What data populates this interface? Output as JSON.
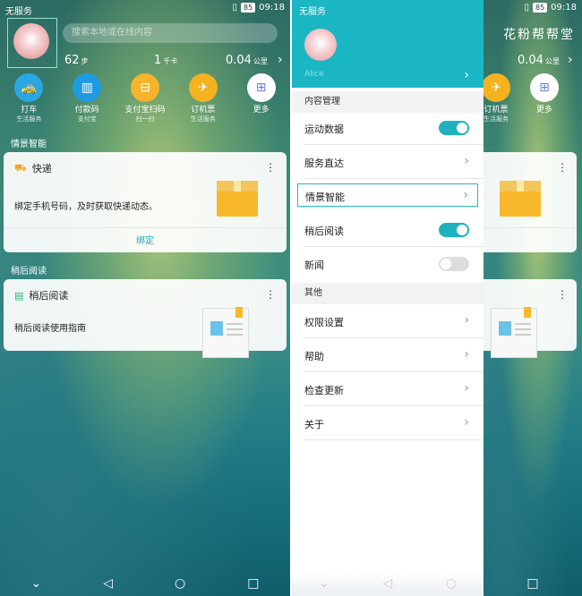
{
  "status_bar": {
    "carrier": "无服务",
    "battery": "85",
    "time": "09:18"
  },
  "home": {
    "search_placeholder": "搜索本地或在线内容",
    "stats": {
      "steps": "62",
      "steps_unit": "步",
      "calories": "1",
      "calories_unit": "千卡",
      "distance": "0.04",
      "distance_unit": "公里"
    },
    "quick_actions": [
      {
        "label": "打车",
        "sub": "生活服务",
        "color": "#2aa7e3",
        "icon": "taxi-icon"
      },
      {
        "label": "付款码",
        "sub": "支付宝",
        "color": "#1f9be3",
        "icon": "barcode-icon"
      },
      {
        "label": "支付宝扫码",
        "sub": "扫一扫",
        "color": "#f6b32b",
        "icon": "scan-icon"
      },
      {
        "label": "订机票",
        "sub": "生活服务",
        "color": "#f5b21f",
        "icon": "plane-icon"
      },
      {
        "label": "更多",
        "sub": "",
        "color": "#ffffff",
        "icon": "grid-icon"
      }
    ],
    "section_smart": "情景智能",
    "express_card": {
      "title": "快递",
      "body": "绑定手机号码，及时获取快递动态。",
      "action": "绑定"
    },
    "section_later": "稍后阅读",
    "later_card": {
      "title": "稍后阅读",
      "body": "稍后阅读使用指南"
    }
  },
  "settings": {
    "username": "Alice",
    "section_content": "内容管理",
    "section_other": "其他",
    "rows_content": [
      {
        "label": "运动数据",
        "type": "toggle",
        "on": true
      },
      {
        "label": "服务直达",
        "type": "arrow"
      },
      {
        "label": "情景智能",
        "type": "arrow",
        "highlight": true
      },
      {
        "label": "稍后阅读",
        "type": "toggle",
        "on": true
      },
      {
        "label": "新闻",
        "type": "toggle",
        "on": false
      }
    ],
    "rows_other": [
      {
        "label": "权限设置"
      },
      {
        "label": "帮助"
      },
      {
        "label": "检查更新"
      },
      {
        "label": "关于"
      }
    ]
  },
  "right_screen": {
    "distance": "0.04",
    "distance_unit": "公里",
    "action_1": "订机票",
    "action_1_sub": "生活服务",
    "action_2": "更多"
  },
  "watermark": "花粉帮帮堂"
}
